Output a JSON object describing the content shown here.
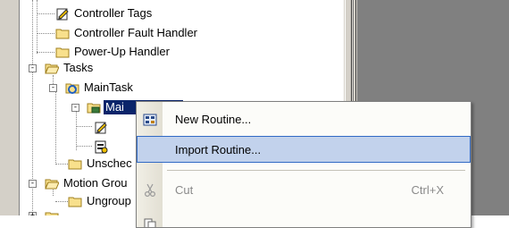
{
  "tree": {
    "items": [
      {
        "label": "Controller Tags",
        "icon": "tags-icon"
      },
      {
        "label": "Controller Fault Handler",
        "icon": "folder-icon"
      },
      {
        "label": "Power-Up Handler",
        "icon": "folder-icon"
      },
      {
        "label": "Tasks",
        "icon": "folder-open-icon",
        "expander": "-"
      },
      {
        "label": "MainTask",
        "icon": "task-icon",
        "expander": "-"
      },
      {
        "label": "Mai",
        "icon": "program-icon",
        "expander": "-",
        "selected": true
      },
      {
        "label": "",
        "icon": "tags-icon"
      },
      {
        "label": "",
        "icon": "routine-icon"
      },
      {
        "label": "Unschec",
        "icon": "folder-icon"
      },
      {
        "label": "Motion Grou",
        "icon": "folder-open-icon",
        "expander": "-"
      },
      {
        "label": "Ungroup",
        "icon": "folder-icon"
      },
      {
        "label": "",
        "icon": "folder-icon",
        "expander": "+"
      }
    ]
  },
  "context_menu": {
    "items": [
      {
        "label": "New Routine...",
        "shortcut": "",
        "icon": "new-routine-icon",
        "state": "normal"
      },
      {
        "label": "Import Routine...",
        "shortcut": "",
        "icon": "",
        "state": "hover"
      },
      {
        "label": "Cut",
        "shortcut": "Ctrl+X",
        "icon": "scissors-icon",
        "state": "disabled"
      }
    ]
  },
  "colors": {
    "selection": "#0a246a",
    "menu_hover": "#c2d2ec",
    "menu_hover_border": "#316ac5",
    "right_pane": "#808080",
    "splitter": "#d4d0c8"
  }
}
